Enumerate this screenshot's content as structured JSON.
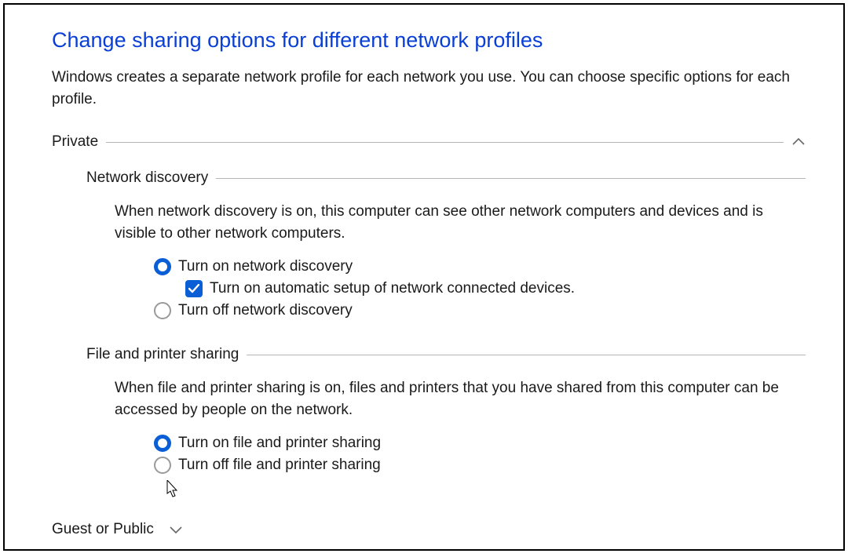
{
  "title": "Change sharing options for different network profiles",
  "description": "Windows creates a separate network profile for each network you use. You can choose specific options for each profile.",
  "profiles": {
    "private": {
      "label": "Private",
      "expanded": true,
      "network_discovery": {
        "heading": "Network discovery",
        "description": "When network discovery is on, this computer can see other network computers and devices and is visible to other network computers.",
        "option_on": "Turn on network discovery",
        "option_auto_setup": "Turn on automatic setup of network connected devices.",
        "option_off": "Turn off network discovery",
        "selected": "on",
        "auto_setup_checked": true
      },
      "file_printer_sharing": {
        "heading": "File and printer sharing",
        "description": "When file and printer sharing is on, files and printers that you have shared from this computer can be accessed by people on the network.",
        "option_on": "Turn on file and printer sharing",
        "option_off": "Turn off file and printer sharing",
        "selected": "on"
      }
    },
    "guest_public": {
      "label": "Guest or Public",
      "expanded": false
    }
  },
  "icons": {
    "chevron_up": "⌃",
    "chevron_down": "⌄",
    "check": "✓"
  }
}
